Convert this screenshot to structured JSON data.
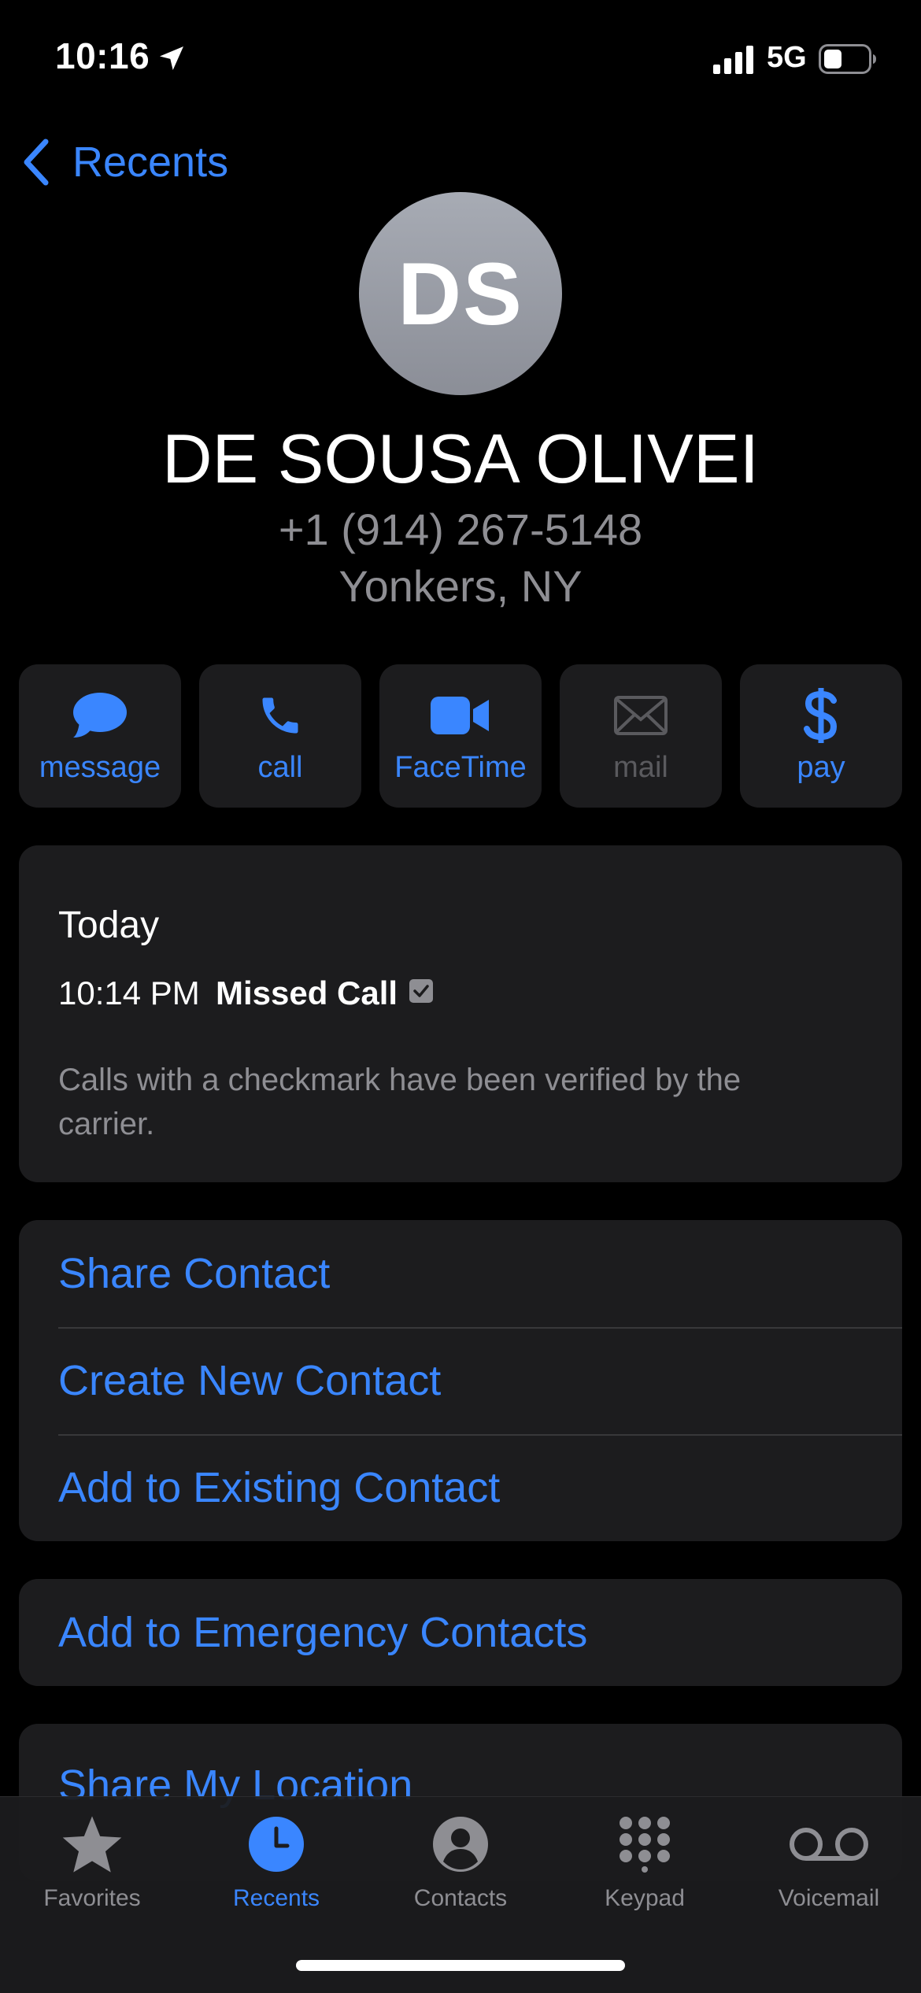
{
  "status_bar": {
    "time": "10:16",
    "network": "5G",
    "icons": [
      "location-arrow-icon",
      "signal-bars-icon",
      "battery-icon"
    ]
  },
  "nav": {
    "back_label": "Recents",
    "back_icon": "chevron-left-icon"
  },
  "contact": {
    "initials": "DS",
    "name": "DE SOUSA OLIVEI",
    "number": "+1 (914) 267-5148",
    "location": "Yonkers, NY"
  },
  "actions": [
    {
      "label": "message",
      "icon": "message-bubble-icon",
      "enabled": true
    },
    {
      "label": "call",
      "icon": "phone-icon",
      "enabled": true
    },
    {
      "label": "FaceTime",
      "icon": "video-camera-icon",
      "enabled": true
    },
    {
      "label": "mail",
      "icon": "envelope-icon",
      "enabled": false
    },
    {
      "label": "pay",
      "icon": "dollar-icon",
      "enabled": true
    }
  ],
  "call_history": {
    "day": "Today",
    "entries": [
      {
        "time": "10:14 PM",
        "type": "Missed Call",
        "verified_icon": "checkmark-box-icon"
      }
    ],
    "note": "Calls with a checkmark have been verified by the carrier."
  },
  "contact_options": [
    "Share Contact",
    "Create New Contact",
    "Add to Existing Contact"
  ],
  "emergency_option": "Add to Emergency Contacts",
  "location_option": "Share My Location",
  "tab_bar": {
    "tabs": [
      {
        "label": "Favorites",
        "icon": "star-icon",
        "active": false
      },
      {
        "label": "Recents",
        "icon": "clock-icon",
        "active": true
      },
      {
        "label": "Contacts",
        "icon": "person-circle-icon",
        "active": false
      },
      {
        "label": "Keypad",
        "icon": "keypad-icon",
        "active": false
      },
      {
        "label": "Voicemail",
        "icon": "voicemail-icon",
        "active": false
      }
    ]
  },
  "colors": {
    "accent": "#3a86ff",
    "background": "#000000",
    "card": "#1c1c1e",
    "secondary_text": "#8e8e93"
  }
}
